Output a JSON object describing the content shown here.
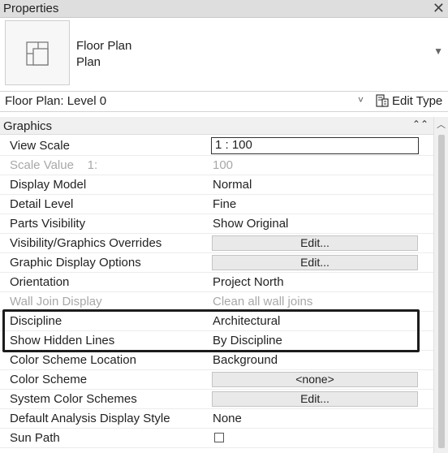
{
  "window": {
    "title": "Properties",
    "close_glyph": "✕"
  },
  "type_selector": {
    "line1": "Floor Plan",
    "line2": "Plan",
    "dropdown_icon": "chevron-down-icon"
  },
  "instance": {
    "label": "Floor Plan: Level 0",
    "edit_type_label": "Edit Type"
  },
  "group": {
    "label": "Graphics"
  },
  "properties": [
    {
      "name": "View Scale",
      "value": "1 : 100",
      "kind": "input",
      "disabled": false
    },
    {
      "name": "Scale Value    1:",
      "value": "100",
      "kind": "text",
      "disabled": true
    },
    {
      "name": "Display Model",
      "value": "Normal",
      "kind": "text",
      "disabled": false
    },
    {
      "name": "Detail Level",
      "value": "Fine",
      "kind": "text",
      "disabled": false
    },
    {
      "name": "Parts Visibility",
      "value": "Show Original",
      "kind": "text",
      "disabled": false
    },
    {
      "name": "Visibility/Graphics Overrides",
      "value": "Edit...",
      "kind": "button",
      "disabled": false
    },
    {
      "name": "Graphic Display Options",
      "value": "Edit...",
      "kind": "button",
      "disabled": false
    },
    {
      "name": "Orientation",
      "value": "Project North",
      "kind": "text",
      "disabled": false
    },
    {
      "name": "Wall Join Display",
      "value": "Clean all wall joins",
      "kind": "text",
      "disabled": true
    },
    {
      "name": "Discipline",
      "value": "Architectural",
      "kind": "text",
      "disabled": false
    },
    {
      "name": "Show Hidden Lines",
      "value": "By Discipline",
      "kind": "text",
      "disabled": false
    },
    {
      "name": "Color Scheme Location",
      "value": "Background",
      "kind": "text",
      "disabled": false
    },
    {
      "name": "Color Scheme",
      "value": "<none>",
      "kind": "button",
      "disabled": false
    },
    {
      "name": "System Color Schemes",
      "value": "Edit...",
      "kind": "button",
      "disabled": false
    },
    {
      "name": "Default Analysis Display Style",
      "value": "None",
      "kind": "text",
      "disabled": false
    },
    {
      "name": "Sun Path",
      "value": "",
      "kind": "checkbox",
      "disabled": false
    }
  ]
}
